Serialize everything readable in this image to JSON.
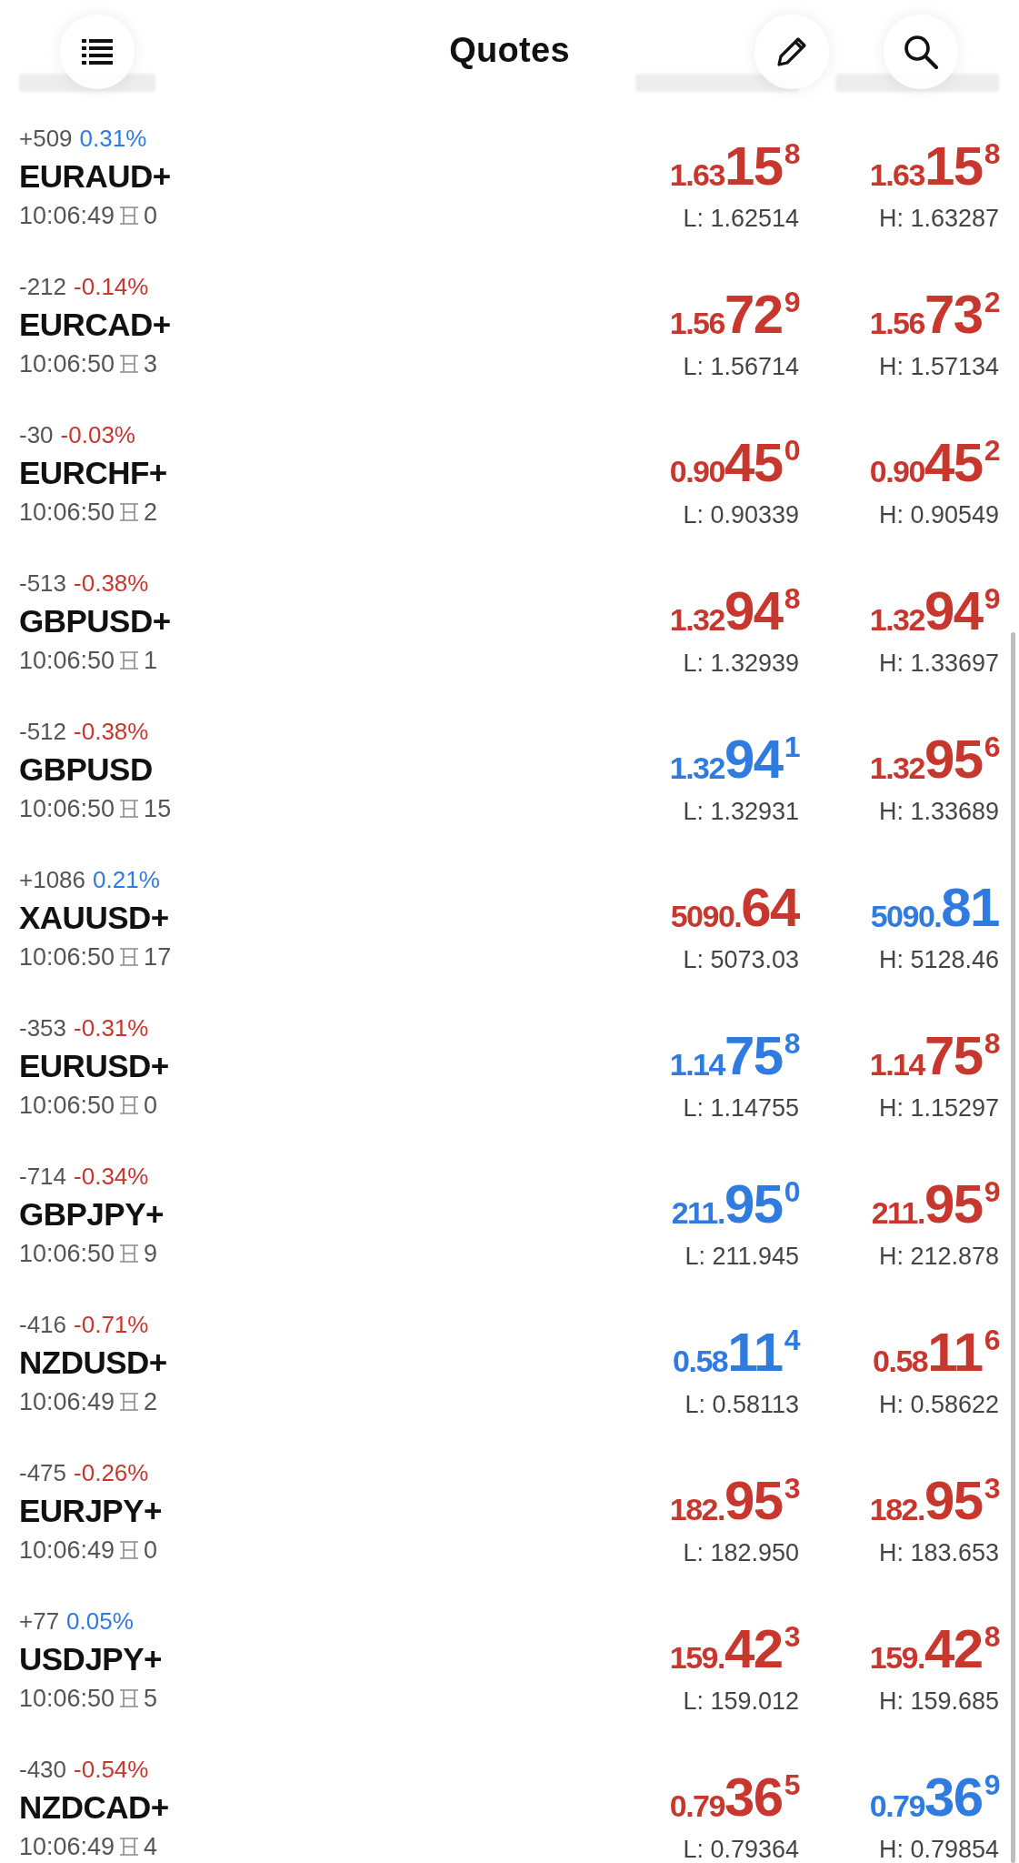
{
  "title": "Quotes",
  "quotes": [
    {
      "change": "+509",
      "percent": "0.31%",
      "rising": true,
      "symbol": "EURAUD+",
      "time": "10:06:49",
      "spread": "0",
      "bid": {
        "head": "1.63",
        "big": "15",
        "sup": "8",
        "rising": false
      },
      "ask": {
        "head": "1.63",
        "big": "15",
        "sup": "8",
        "rising": false
      },
      "low": "L: 1.62514",
      "high": "H: 1.63287"
    },
    {
      "change": "-212",
      "percent": "-0.14%",
      "rising": false,
      "symbol": "EURCAD+",
      "time": "10:06:50",
      "spread": "3",
      "bid": {
        "head": "1.56",
        "big": "72",
        "sup": "9",
        "rising": false
      },
      "ask": {
        "head": "1.56",
        "big": "73",
        "sup": "2",
        "rising": false
      },
      "low": "L: 1.56714",
      "high": "H: 1.57134"
    },
    {
      "change": "-30",
      "percent": "-0.03%",
      "rising": false,
      "symbol": "EURCHF+",
      "time": "10:06:50",
      "spread": "2",
      "bid": {
        "head": "0.90",
        "big": "45",
        "sup": "0",
        "rising": false
      },
      "ask": {
        "head": "0.90",
        "big": "45",
        "sup": "2",
        "rising": false
      },
      "low": "L: 0.90339",
      "high": "H: 0.90549"
    },
    {
      "change": "-513",
      "percent": "-0.38%",
      "rising": false,
      "symbol": "GBPUSD+",
      "time": "10:06:50",
      "spread": "1",
      "bid": {
        "head": "1.32",
        "big": "94",
        "sup": "8",
        "rising": false
      },
      "ask": {
        "head": "1.32",
        "big": "94",
        "sup": "9",
        "rising": false
      },
      "low": "L: 1.32939",
      "high": "H: 1.33697"
    },
    {
      "change": "-512",
      "percent": "-0.38%",
      "rising": false,
      "symbol": "GBPUSD",
      "time": "10:06:50",
      "spread": "15",
      "bid": {
        "head": "1.32",
        "big": "94",
        "sup": "1",
        "rising": true
      },
      "ask": {
        "head": "1.32",
        "big": "95",
        "sup": "6",
        "rising": false
      },
      "low": "L: 1.32931",
      "high": "H: 1.33689"
    },
    {
      "change": "+1086",
      "percent": "0.21%",
      "rising": true,
      "symbol": "XAUUSD+",
      "time": "10:06:50",
      "spread": "17",
      "bid": {
        "head": "5090.",
        "big": "64",
        "rising": false
      },
      "ask": {
        "head": "5090.",
        "big": "81",
        "rising": true
      },
      "low": "L: 5073.03",
      "high": "H: 5128.46"
    },
    {
      "change": "-353",
      "percent": "-0.31%",
      "rising": false,
      "symbol": "EURUSD+",
      "time": "10:06:50",
      "spread": "0",
      "bid": {
        "head": "1.14",
        "big": "75",
        "sup": "8",
        "rising": true
      },
      "ask": {
        "head": "1.14",
        "big": "75",
        "sup": "8",
        "rising": false
      },
      "low": "L: 1.14755",
      "high": "H: 1.15297"
    },
    {
      "change": "-714",
      "percent": "-0.34%",
      "rising": false,
      "symbol": "GBPJPY+",
      "time": "10:06:50",
      "spread": "9",
      "bid": {
        "head": "211.",
        "big": "95",
        "sup": "0",
        "rising": true
      },
      "ask": {
        "head": "211.",
        "big": "95",
        "sup": "9",
        "rising": false
      },
      "low": "L: 211.945",
      "high": "H: 212.878"
    },
    {
      "change": "-416",
      "percent": "-0.71%",
      "rising": false,
      "symbol": "NZDUSD+",
      "time": "10:06:49",
      "spread": "2",
      "bid": {
        "head": "0.58",
        "big": "11",
        "sup": "4",
        "rising": true
      },
      "ask": {
        "head": "0.58",
        "big": "11",
        "sup": "6",
        "rising": false
      },
      "low": "L: 0.58113",
      "high": "H: 0.58622"
    },
    {
      "change": "-475",
      "percent": "-0.26%",
      "rising": false,
      "symbol": "EURJPY+",
      "time": "10:06:49",
      "spread": "0",
      "bid": {
        "head": "182.",
        "big": "95",
        "sup": "3",
        "rising": false
      },
      "ask": {
        "head": "182.",
        "big": "95",
        "sup": "3",
        "rising": false
      },
      "low": "L: 182.950",
      "high": "H: 183.653"
    },
    {
      "change": "+77",
      "percent": "0.05%",
      "rising": true,
      "symbol": "USDJPY+",
      "time": "10:06:50",
      "spread": "5",
      "bid": {
        "head": "159.",
        "big": "42",
        "sup": "3",
        "rising": false
      },
      "ask": {
        "head": "159.",
        "big": "42",
        "sup": "8",
        "rising": false
      },
      "low": "L: 159.012",
      "high": "H: 159.685"
    },
    {
      "change": "-430",
      "percent": "-0.54%",
      "rising": false,
      "symbol": "NZDCAD+",
      "time": "10:06:49",
      "spread": "4",
      "bid": {
        "head": "0.79",
        "big": "36",
        "sup": "5",
        "rising": false
      },
      "ask": {
        "head": "0.79",
        "big": "36",
        "sup": "9",
        "rising": true
      },
      "low": "L: 0.79364",
      "high": "H: 0.79854"
    }
  ]
}
